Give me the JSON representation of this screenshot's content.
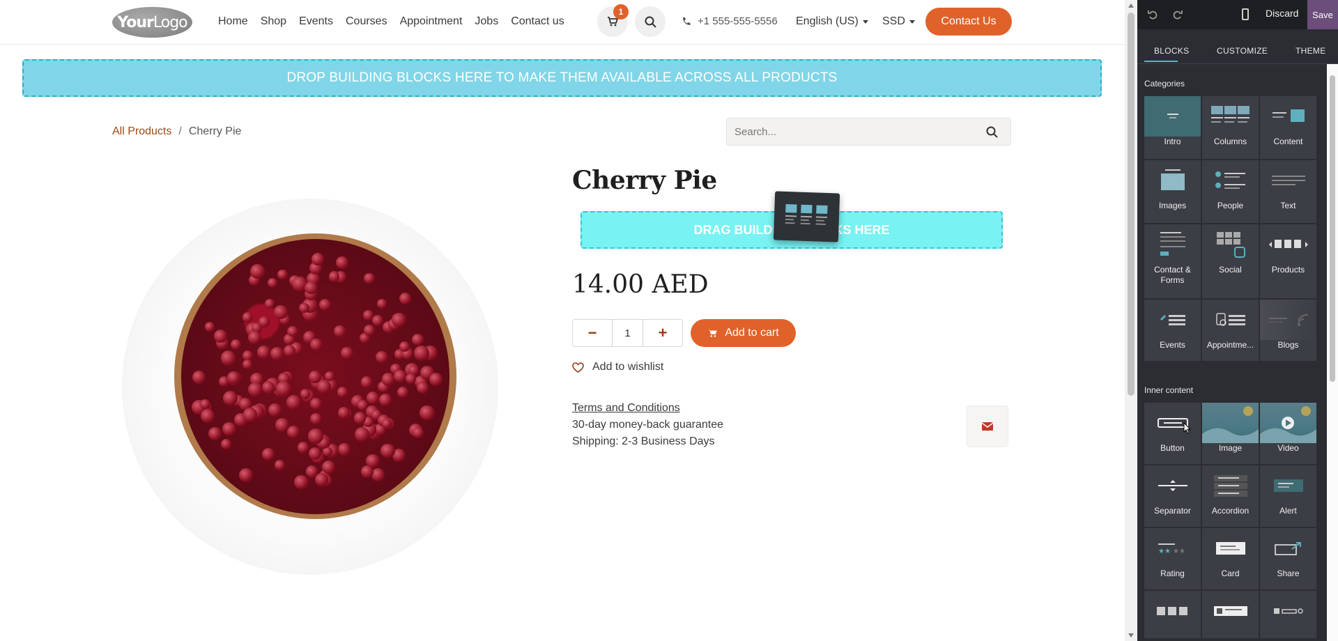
{
  "header": {
    "logo_text_bold": "Your",
    "logo_text": "Logo",
    "nav": [
      "Home",
      "Shop",
      "Events",
      "Courses",
      "Appointment",
      "Jobs",
      "Contact us"
    ],
    "cart_count": "1",
    "phone": "+1 555-555-5556",
    "language": "English (US)",
    "currency": "SSD",
    "contact_button": "Contact Us"
  },
  "global_drop_zone": "DROP BUILDING BLOCKS HERE TO MAKE THEM AVAILABLE ACROSS ALL PRODUCTS",
  "breadcrumb": {
    "parent": "All Products",
    "separator": "/",
    "current": "Cherry Pie"
  },
  "search": {
    "placeholder": "Search..."
  },
  "product": {
    "title": "Cherry Pie",
    "drag_zone": "DRAG BUILDING BLOCKS HERE",
    "price": "14.00 AED",
    "quantity": "1",
    "add_to_cart": "Add to cart",
    "wishlist": "Add to wishlist",
    "terms": "Terms and Conditions",
    "guarantee": "30-day money-back guarantee",
    "shipping": "Shipping: 2-3 Business Days"
  },
  "editor": {
    "discard": "Discard",
    "save": "Save",
    "tabs": [
      "BLOCKS",
      "CUSTOMIZE",
      "THEME"
    ],
    "categories_label": "Categories",
    "categories": [
      {
        "label": "Intro",
        "icon": "intro-icon"
      },
      {
        "label": "Columns",
        "icon": "columns-icon"
      },
      {
        "label": "Content",
        "icon": "content-icon"
      },
      {
        "label": "Images",
        "icon": "images-icon"
      },
      {
        "label": "People",
        "icon": "people-icon"
      },
      {
        "label": "Text",
        "icon": "text-icon"
      },
      {
        "label": "Contact & Forms",
        "icon": "forms-icon"
      },
      {
        "label": "Social",
        "icon": "social-icon"
      },
      {
        "label": "Products",
        "icon": "products-icon"
      },
      {
        "label": "Events",
        "icon": "events-icon"
      },
      {
        "label": "Appointme...",
        "icon": "appointment-icon"
      },
      {
        "label": "Blogs",
        "icon": "blogs-icon"
      }
    ],
    "inner_label": "Inner content",
    "inner": [
      {
        "label": "Button",
        "icon": "button-icon"
      },
      {
        "label": "Image",
        "icon": "image-icon"
      },
      {
        "label": "Video",
        "icon": "video-icon"
      },
      {
        "label": "Separator",
        "icon": "separator-icon"
      },
      {
        "label": "Accordion",
        "icon": "accordion-icon"
      },
      {
        "label": "Alert",
        "icon": "alert-icon"
      },
      {
        "label": "Rating",
        "icon": "rating-icon"
      },
      {
        "label": "Card",
        "icon": "card-icon"
      },
      {
        "label": "Share",
        "icon": "share-icon"
      }
    ]
  },
  "colors": {
    "accent": "#e0622a",
    "editor_bg": "#2b2d33",
    "drop_zone": "#80d6e8",
    "save_bg": "#6b4e7a"
  }
}
